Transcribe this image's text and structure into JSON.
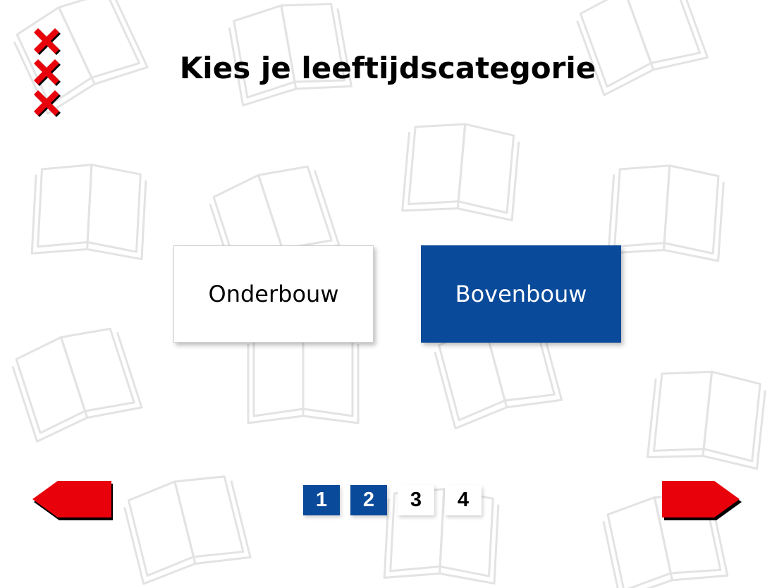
{
  "title": "Kies je leeftijdscategorie",
  "options": [
    {
      "label": "Onderbouw",
      "selected": false
    },
    {
      "label": "Bovenbouw",
      "selected": true
    }
  ],
  "pager": {
    "pages": [
      "1",
      "2",
      "3",
      "4"
    ],
    "current": 2
  },
  "colors": {
    "primary_blue": "#0a4a9a",
    "arrow_red": "#e8000b",
    "background": "#ffffff",
    "book_outline": "#e6e6e6"
  },
  "icons": {
    "logo": "amsterdam-xxx-icon",
    "prev": "arrow-left-icon",
    "next": "arrow-right-icon",
    "background_pattern": "open-book-icon"
  }
}
